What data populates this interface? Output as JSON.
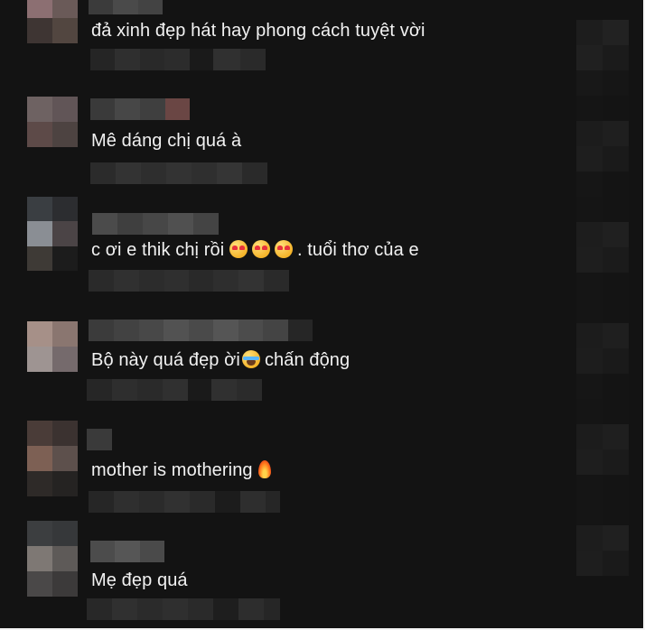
{
  "comments": [
    {
      "text": "đả xinh đẹp hát hay phong cách tuyệt vời"
    },
    {
      "text": "Mê dáng chị quá à"
    },
    {
      "text": "c ơi e thik chị rồi",
      "text_after": ". tuổi thơ của e",
      "emoji": "heart-eyes-icon"
    },
    {
      "text": "Bộ này quá đẹp ời",
      "text_after": "chấn động",
      "emoji": "loudly-crying-icon"
    },
    {
      "text": "mother is mothering",
      "emoji": "fire-icon"
    },
    {
      "text": "Mẹ đẹp quá"
    }
  ],
  "colors": {
    "background": "#131313",
    "text": "#f2f2f2",
    "frame_border": "#f4f4f4"
  }
}
